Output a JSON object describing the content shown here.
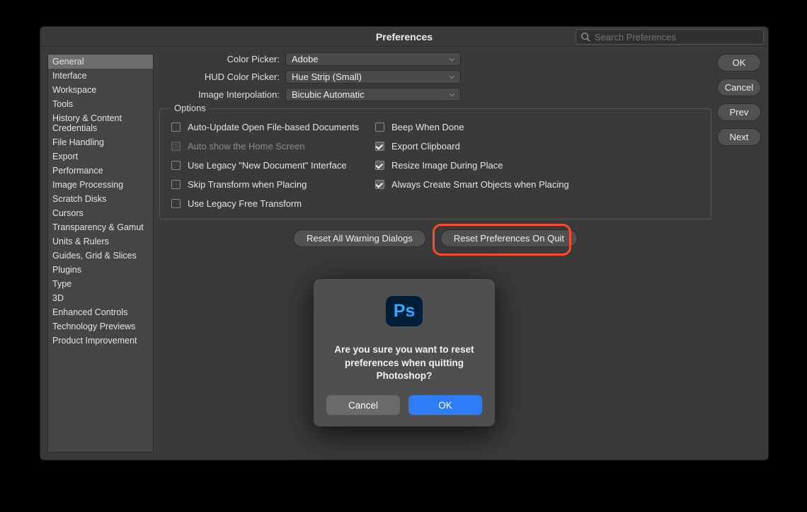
{
  "window": {
    "title": "Preferences"
  },
  "search": {
    "placeholder": "Search Preferences",
    "value": ""
  },
  "sidebar": {
    "selected_index": 0,
    "items": [
      {
        "label": "General"
      },
      {
        "label": "Interface"
      },
      {
        "label": "Workspace"
      },
      {
        "label": "Tools"
      },
      {
        "label": "History & Content Credentials"
      },
      {
        "label": "File Handling"
      },
      {
        "label": "Export"
      },
      {
        "label": "Performance"
      },
      {
        "label": "Image Processing"
      },
      {
        "label": "Scratch Disks"
      },
      {
        "label": "Cursors"
      },
      {
        "label": "Transparency & Gamut"
      },
      {
        "label": "Units & Rulers"
      },
      {
        "label": "Guides, Grid & Slices"
      },
      {
        "label": "Plugins"
      },
      {
        "label": "Type"
      },
      {
        "label": "3D"
      },
      {
        "label": "Enhanced Controls"
      },
      {
        "label": "Technology Previews"
      },
      {
        "label": "Product Improvement"
      }
    ]
  },
  "buttons": {
    "ok": "OK",
    "cancel": "Cancel",
    "prev": "Prev",
    "next": "Next"
  },
  "form": {
    "color_picker": {
      "label": "Color Picker:",
      "value": "Adobe"
    },
    "hud_color_picker": {
      "label": "HUD Color Picker:",
      "value": "Hue Strip (Small)"
    },
    "image_interpolation": {
      "label": "Image Interpolation:",
      "value": "Bicubic Automatic"
    }
  },
  "options": {
    "legend": "Options",
    "left": [
      {
        "label": "Auto-Update Open File-based Documents",
        "checked": false,
        "disabled": false
      },
      {
        "label": "Auto show the Home Screen",
        "checked": false,
        "disabled": true
      },
      {
        "label": "Use Legacy \"New Document\" Interface",
        "checked": false,
        "disabled": false
      },
      {
        "label": "Skip Transform when Placing",
        "checked": false,
        "disabled": false
      },
      {
        "label": "Use Legacy Free Transform",
        "checked": false,
        "disabled": false
      }
    ],
    "right": [
      {
        "label": "Beep When Done",
        "checked": false,
        "disabled": false
      },
      {
        "label": "Export Clipboard",
        "checked": true,
        "disabled": false
      },
      {
        "label": "Resize Image During Place",
        "checked": true,
        "disabled": false
      },
      {
        "label": "Always Create Smart Objects when Placing",
        "checked": true,
        "disabled": false
      }
    ]
  },
  "big_buttons": {
    "reset_warnings": "Reset All Warning Dialogs",
    "reset_on_quit": "Reset Preferences On Quit"
  },
  "modal": {
    "icon_text": "Ps",
    "message": "Are you sure you want to reset preferences when quitting Photoshop?",
    "cancel": "Cancel",
    "ok": "OK"
  }
}
